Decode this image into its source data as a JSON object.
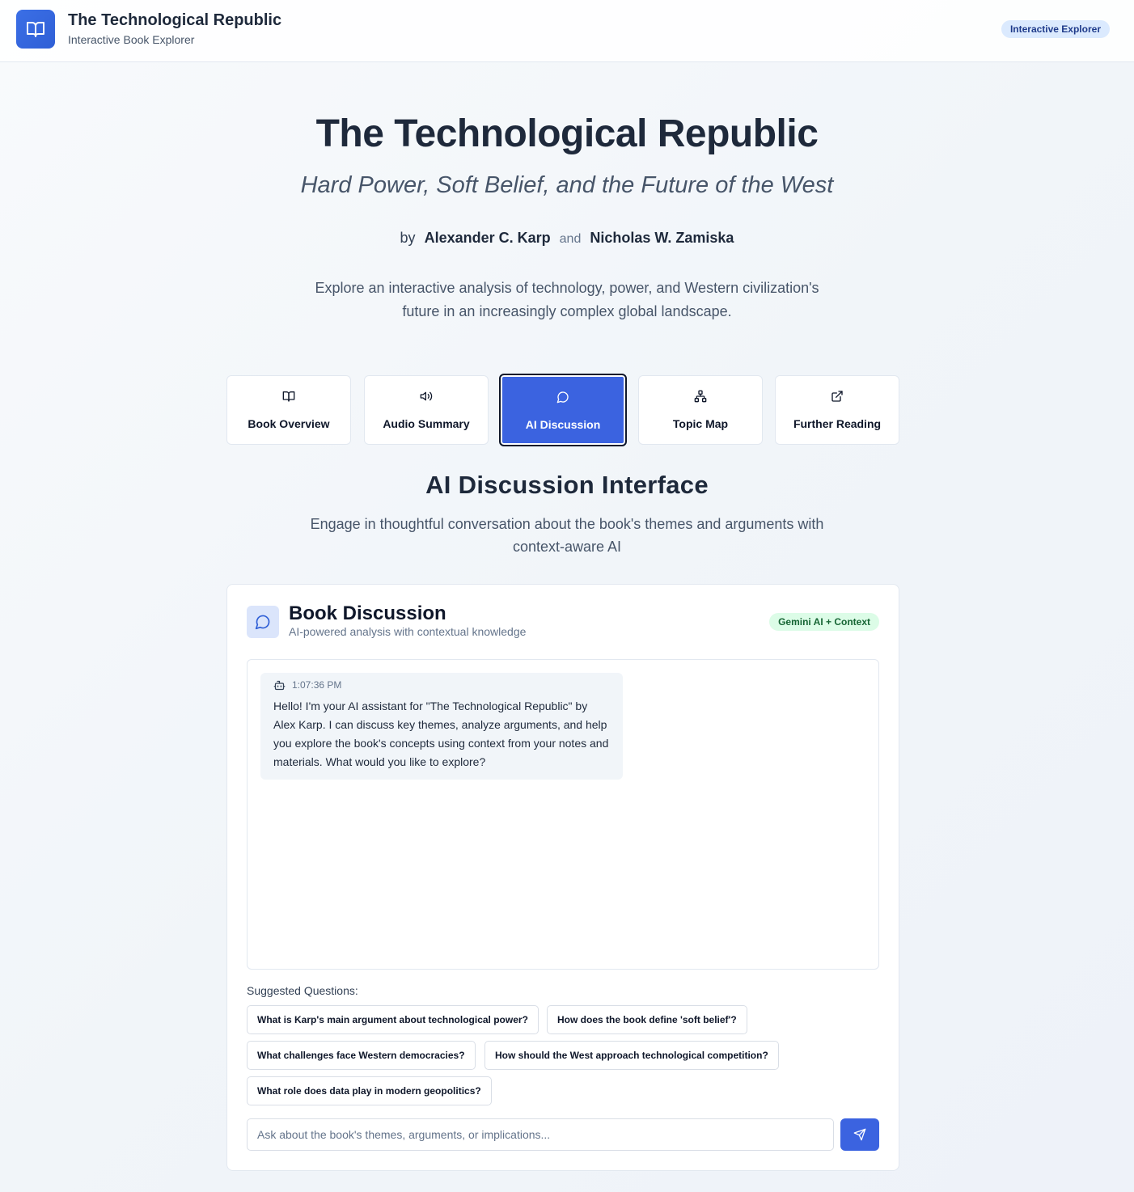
{
  "header": {
    "app_title": "The Technological Republic",
    "app_subtitle": "Interactive Book Explorer",
    "badge": "Interactive Explorer",
    "logo_icon": "open-book-icon"
  },
  "hero": {
    "title": "The Technological Republic",
    "subtitle": "Hard Power, Soft Belief, and the Future of the West",
    "by": "by",
    "author1": "Alexander C. Karp",
    "and": "and",
    "author2": "Nicholas W. Zamiska",
    "description": "Explore an interactive analysis of technology, power, and Western civilization's future in an increasingly complex global landscape."
  },
  "nav": {
    "tabs": [
      {
        "label": "Book Overview",
        "icon": "book-icon",
        "active": false
      },
      {
        "label": "Audio Summary",
        "icon": "speaker-icon",
        "active": false
      },
      {
        "label": "AI Discussion",
        "icon": "chat-bubble-icon",
        "active": true
      },
      {
        "label": "Topic Map",
        "icon": "network-icon",
        "active": false
      },
      {
        "label": "Further Reading",
        "icon": "external-link-icon",
        "active": false
      }
    ]
  },
  "section": {
    "title": "AI Discussion Interface",
    "description": "Engage in thoughtful conversation about the book's themes and arguments with context-aware AI"
  },
  "discussion": {
    "title": "Book Discussion",
    "subtitle": "AI-powered analysis with contextual knowledge",
    "badge": "Gemini AI + Context",
    "messages": [
      {
        "sender_icon": "bot-icon",
        "time": "1:07:36 PM",
        "text": "Hello! I'm your AI assistant for \"The Technological Republic\" by Alex Karp. I can discuss key themes, analyze arguments, and help you explore the book's concepts using context from your notes and materials. What would you like to explore?"
      }
    ],
    "suggested_label": "Suggested Questions:",
    "suggested": [
      "What is Karp's main argument about technological power?",
      "How does the book define 'soft belief'?",
      "What challenges face Western democracies?",
      "How should the West approach technological competition?",
      "What role does data play in modern geopolitics?"
    ],
    "input_value": "",
    "input_placeholder": "Ask about the book's themes, arguments, or implications...",
    "send_icon": "send-icon"
  },
  "colors": {
    "accent": "#3b63e0",
    "badge_blue_bg": "#dbeafe",
    "badge_green_bg": "#dcfce7",
    "text_dark": "#1e293b"
  }
}
